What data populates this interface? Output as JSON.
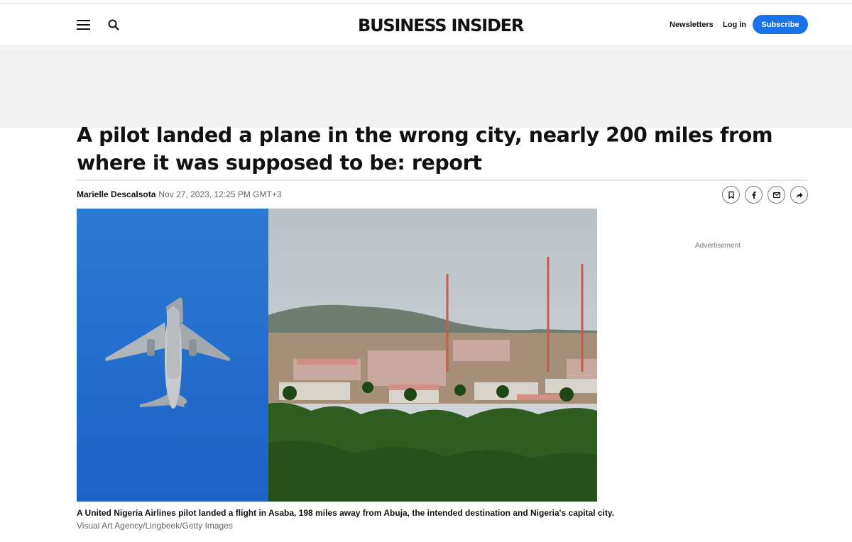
{
  "header": {
    "logo": "BUSINESS INSIDER",
    "menu_icon": "hamburger-menu-icon",
    "search_icon": "search-icon",
    "newsletters": "Newsletters",
    "login": "Log in",
    "subscribe": "Subscribe"
  },
  "article": {
    "headline": "A pilot landed a plane in the wrong city, nearly 200 miles from where it was supposed to be: report",
    "author": "Marielle Descalsota",
    "date": "Nov 27, 2023, 12:25 PM GMT+3",
    "share": [
      "bookmark-icon",
      "facebook-icon",
      "email-icon",
      "share-arrow-icon"
    ],
    "caption": "A United Nigeria Airlines pilot landed a flight in Asaba, 198 miles away from Abuja, the intended destination and Nigeria's capital city.",
    "credit": "Visual Art Agency/Lingbeek/Getty Images"
  },
  "sidebar": {
    "ad_label": "Advertisement"
  },
  "colors": {
    "accent": "#1a73e8",
    "sky": "#2f7fd6"
  }
}
